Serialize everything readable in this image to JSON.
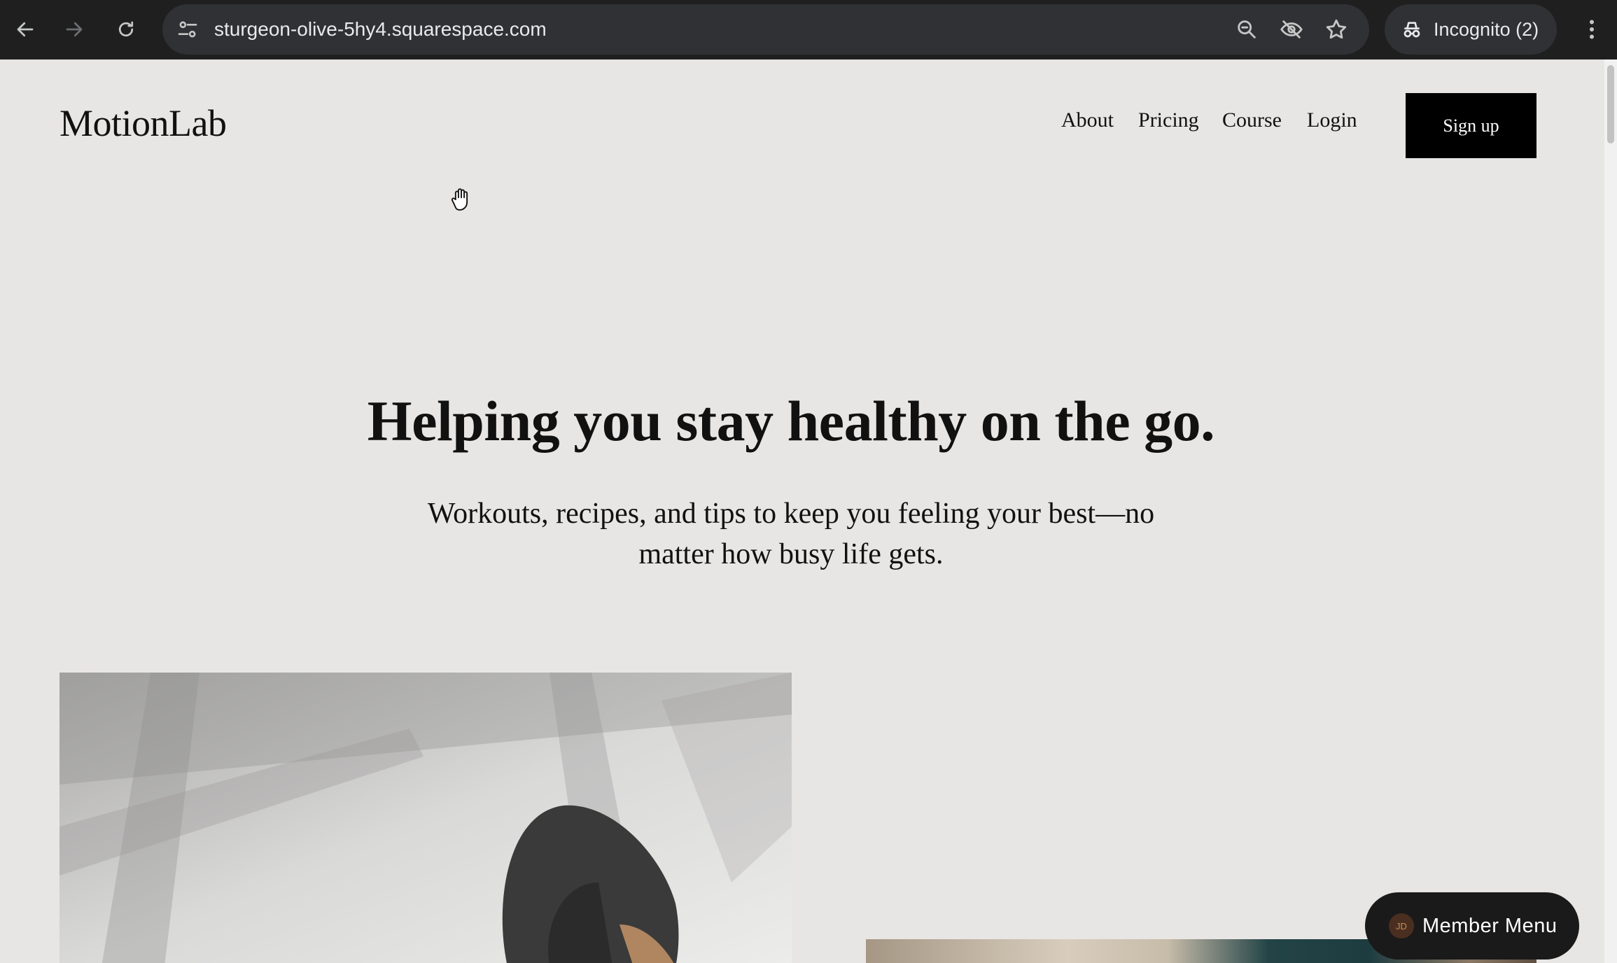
{
  "browser": {
    "url": "sturgeon-olive-5hy4.squarespace.com",
    "incognito_label": "Incognito (2)",
    "icons": [
      "back-arrow-icon",
      "forward-arrow-icon",
      "reload-icon",
      "site-settings-icon",
      "zoom-icon",
      "eye-off-icon",
      "star-icon",
      "incognito-icon",
      "kebab-menu-icon"
    ]
  },
  "site": {
    "logo": "MotionLab",
    "nav": [
      "About",
      "Pricing",
      "Course",
      "Login"
    ],
    "signup_label": "Sign up"
  },
  "hero": {
    "title": "Helping you stay healthy on the go.",
    "subtitle": "Workouts, recipes, and tips to keep you feeling your best—no matter how busy life gets."
  },
  "member_menu": {
    "avatar_initials": "JD",
    "label": "Member Menu"
  },
  "colors": {
    "page_background": "#e8e6e4",
    "chrome_background": "#1f1f1f",
    "button_background": "#000000"
  }
}
